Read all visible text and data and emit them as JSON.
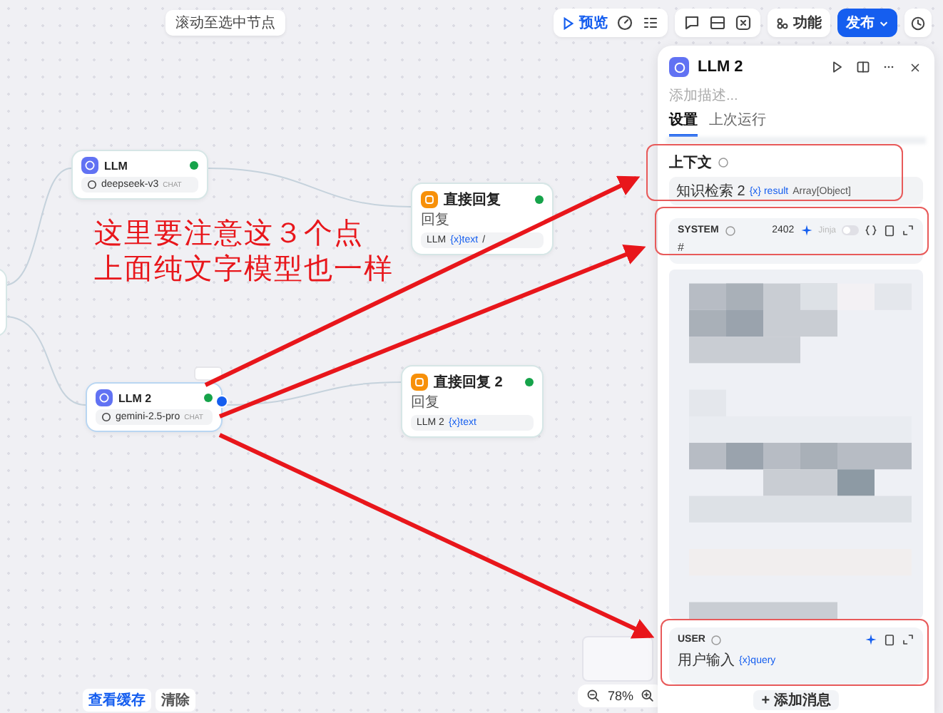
{
  "canvas_hint": "滚动至选中节点",
  "toolbar": {
    "preview": "预览",
    "features": "功能",
    "publish": "发布"
  },
  "nodes": [
    {
      "kind": "llm",
      "title": "LLM",
      "model": "deepseek-v3",
      "mode": "CHAT",
      "selected": false
    },
    {
      "kind": "answer",
      "title": "直接回复",
      "label": "回复",
      "ref": "LLM",
      "var": "{x}text",
      "trail": "/"
    },
    {
      "kind": "llm",
      "title": "LLM 2",
      "model": "gemini-2.5-pro",
      "mode": "CHAT",
      "selected": true
    },
    {
      "kind": "answer",
      "title": "直接回复 2",
      "label": "回复",
      "ref": "LLM 2",
      "var": "{x}text"
    }
  ],
  "annotation": {
    "lines": [
      "这里要注意这３个点",
      "上面纯文字模型也一样"
    ]
  },
  "footer": {
    "cache": "查看缓存",
    "clear": "清除"
  },
  "zoom": "78%",
  "panel": {
    "title": "LLM 2",
    "description_placeholder": "添加描述...",
    "tabs": [
      {
        "label": "设置",
        "selected": true
      },
      {
        "label": "上次运行",
        "selected": false
      }
    ],
    "context": {
      "label": "上下文",
      "source": "知识检索 2",
      "var": "{x} result",
      "type": "Array[Object]"
    },
    "messages": [
      {
        "role": "SYSTEM",
        "count": "2402",
        "jinja": "Jinja",
        "jinja_on": false,
        "body": "#"
      },
      {
        "role": "USER",
        "ref": "用户输入",
        "var": "{x}query"
      }
    ],
    "add_message": "+ 添加消息"
  }
}
